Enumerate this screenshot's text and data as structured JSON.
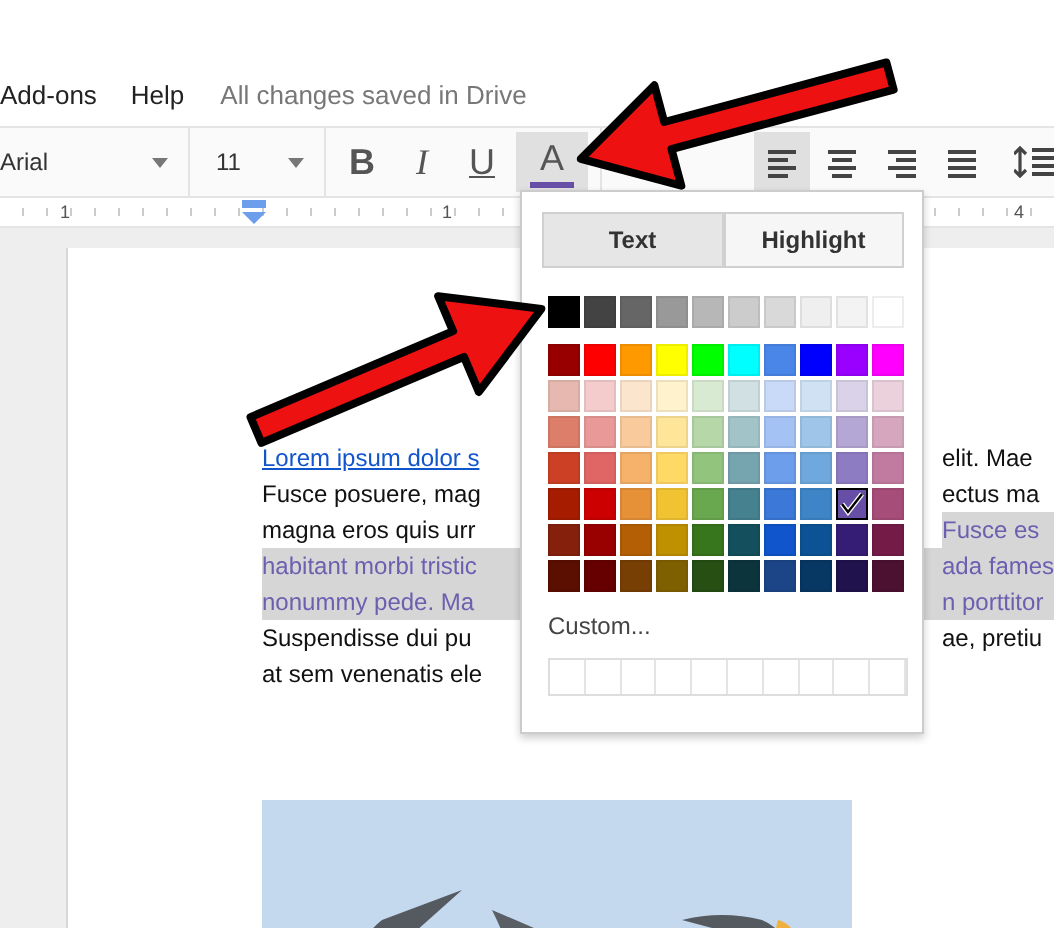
{
  "menu_bar": {
    "items": [
      "Add-ons",
      "Help"
    ],
    "status": "All changes saved in Drive"
  },
  "toolbar": {
    "font": "Arial",
    "size": "11",
    "format_buttons": [
      {
        "label": "B",
        "kind": "bold",
        "selected": false
      },
      {
        "label": "I",
        "kind": "italic",
        "selected": false
      },
      {
        "label": "U",
        "kind": "underline",
        "selected": false
      },
      {
        "label": "A",
        "kind": "color",
        "selected": true
      }
    ],
    "align_buttons": [
      {
        "kind": "left",
        "selected": true
      },
      {
        "kind": "center",
        "selected": false
      },
      {
        "kind": "right",
        "selected": false
      },
      {
        "kind": "justify",
        "selected": false
      }
    ]
  },
  "ruler": {
    "labels": [
      "1",
      "1",
      "4"
    ]
  },
  "document": {
    "lines": [
      {
        "left": {
          "text": "Lorem ipsum dolor s",
          "kind": "link"
        },
        "right": {
          "text": "elit. Mae",
          "kind": "plain"
        }
      },
      {
        "left": {
          "text": "Fusce posuere, mag",
          "kind": "plain"
        },
        "right": {
          "text": "ectus ma",
          "kind": "plain"
        }
      },
      {
        "left": {
          "text": "magna eros quis urr",
          "kind": "plain"
        },
        "right": {
          "text": "Fusce es",
          "kind": "highlight"
        }
      },
      {
        "left": {
          "text": "habitant morbi tristic",
          "kind": "highlight"
        },
        "right": {
          "text": "ada fames",
          "kind": "highlight"
        }
      },
      {
        "left": {
          "text": "nonummy pede. Ma",
          "kind": "highlight"
        },
        "right": {
          "text": "n porttitor",
          "kind": "highlight"
        }
      },
      {
        "left": {
          "text": "Suspendisse dui pu",
          "kind": "plain"
        },
        "right": {
          "text": "ae, pretiu",
          "kind": "plain"
        }
      },
      {
        "left": {
          "text": "at sem venenatis ele",
          "kind": "plain"
        }
      }
    ]
  },
  "color_picker": {
    "tabs": [
      {
        "label": "Text",
        "selected": true
      },
      {
        "label": "Highlight",
        "selected": false
      }
    ],
    "rows": [
      {
        "kind": "gray",
        "swatches": [
          {
            "color": "#000000",
            "selected": false
          },
          {
            "color": "#434343",
            "selected": false
          },
          {
            "color": "#666666",
            "selected": false
          },
          {
            "color": "#999999",
            "selected": false
          },
          {
            "color": "#b7b7b7",
            "selected": false
          },
          {
            "color": "#cccccc",
            "selected": false
          },
          {
            "color": "#d9d9d9",
            "selected": false
          },
          {
            "color": "#efefef",
            "selected": false
          },
          {
            "color": "#f3f3f3",
            "selected": false
          },
          {
            "color": "#ffffff",
            "selected": false
          }
        ]
      },
      {
        "kind": "bright",
        "swatches": [
          {
            "color": "#980000",
            "selected": false
          },
          {
            "color": "#ff0000",
            "selected": false
          },
          {
            "color": "#ff9900",
            "selected": false
          },
          {
            "color": "#ffff00",
            "selected": false
          },
          {
            "color": "#00ff00",
            "selected": false
          },
          {
            "color": "#00ffff",
            "selected": false
          },
          {
            "color": "#4a86e8",
            "selected": false
          },
          {
            "color": "#0000ff",
            "selected": false
          },
          {
            "color": "#9900ff",
            "selected": false
          },
          {
            "color": "#ff00ff",
            "selected": false
          }
        ]
      },
      {
        "kind": "shade",
        "swatches": [
          {
            "color": "#e6b8af",
            "selected": false
          },
          {
            "color": "#f4cccc",
            "selected": false
          },
          {
            "color": "#fce5cd",
            "selected": false
          },
          {
            "color": "#fff2cc",
            "selected": false
          },
          {
            "color": "#d9ead3",
            "selected": false
          },
          {
            "color": "#d0e0e3",
            "selected": false
          },
          {
            "color": "#c9daf8",
            "selected": false
          },
          {
            "color": "#cfe2f3",
            "selected": false
          },
          {
            "color": "#d9d2e9",
            "selected": false
          },
          {
            "color": "#ead1dc",
            "selected": false
          }
        ]
      },
      {
        "kind": "shade",
        "swatches": [
          {
            "color": "#dd7e6b",
            "selected": false
          },
          {
            "color": "#ea9999",
            "selected": false
          },
          {
            "color": "#f9cb9c",
            "selected": false
          },
          {
            "color": "#ffe599",
            "selected": false
          },
          {
            "color": "#b6d7a8",
            "selected": false
          },
          {
            "color": "#a2c4c9",
            "selected": false
          },
          {
            "color": "#a4c2f4",
            "selected": false
          },
          {
            "color": "#9fc5e8",
            "selected": false
          },
          {
            "color": "#b4a7d6",
            "selected": false
          },
          {
            "color": "#d5a6bd",
            "selected": false
          }
        ]
      },
      {
        "kind": "shade",
        "swatches": [
          {
            "color": "#cc4125",
            "selected": false
          },
          {
            "color": "#e06666",
            "selected": false
          },
          {
            "color": "#f6b26b",
            "selected": false
          },
          {
            "color": "#ffd966",
            "selected": false
          },
          {
            "color": "#93c47d",
            "selected": false
          },
          {
            "color": "#76a5af",
            "selected": false
          },
          {
            "color": "#6d9eeb",
            "selected": false
          },
          {
            "color": "#6fa8dc",
            "selected": false
          },
          {
            "color": "#8e7cc3",
            "selected": false
          },
          {
            "color": "#c27ba0",
            "selected": false
          }
        ]
      },
      {
        "kind": "shade",
        "swatches": [
          {
            "color": "#a61c00",
            "selected": false
          },
          {
            "color": "#cc0000",
            "selected": false
          },
          {
            "color": "#e69138",
            "selected": false
          },
          {
            "color": "#f1c232",
            "selected": false
          },
          {
            "color": "#6aa84f",
            "selected": false
          },
          {
            "color": "#45818e",
            "selected": false
          },
          {
            "color": "#3c78d8",
            "selected": false
          },
          {
            "color": "#3d85c6",
            "selected": false
          },
          {
            "color": "#674ea7",
            "selected": true
          },
          {
            "color": "#a64d79",
            "selected": false
          }
        ]
      },
      {
        "kind": "shade",
        "swatches": [
          {
            "color": "#85200c",
            "selected": false
          },
          {
            "color": "#990000",
            "selected": false
          },
          {
            "color": "#b45f06",
            "selected": false
          },
          {
            "color": "#bf9000",
            "selected": false
          },
          {
            "color": "#38761d",
            "selected": false
          },
          {
            "color": "#134f5c",
            "selected": false
          },
          {
            "color": "#1155cc",
            "selected": false
          },
          {
            "color": "#0b5394",
            "selected": false
          },
          {
            "color": "#351c75",
            "selected": false
          },
          {
            "color": "#741b47",
            "selected": false
          }
        ]
      },
      {
        "kind": "shade",
        "swatches": [
          {
            "color": "#5b0f00",
            "selected": false
          },
          {
            "color": "#660000",
            "selected": false
          },
          {
            "color": "#783f04",
            "selected": false
          },
          {
            "color": "#7f6000",
            "selected": false
          },
          {
            "color": "#274e13",
            "selected": false
          },
          {
            "color": "#0c343d",
            "selected": false
          },
          {
            "color": "#1c4587",
            "selected": false
          },
          {
            "color": "#073763",
            "selected": false
          },
          {
            "color": "#20124d",
            "selected": false
          },
          {
            "color": "#4c1130",
            "selected": false
          }
        ]
      }
    ],
    "custom_label": "Custom..."
  }
}
